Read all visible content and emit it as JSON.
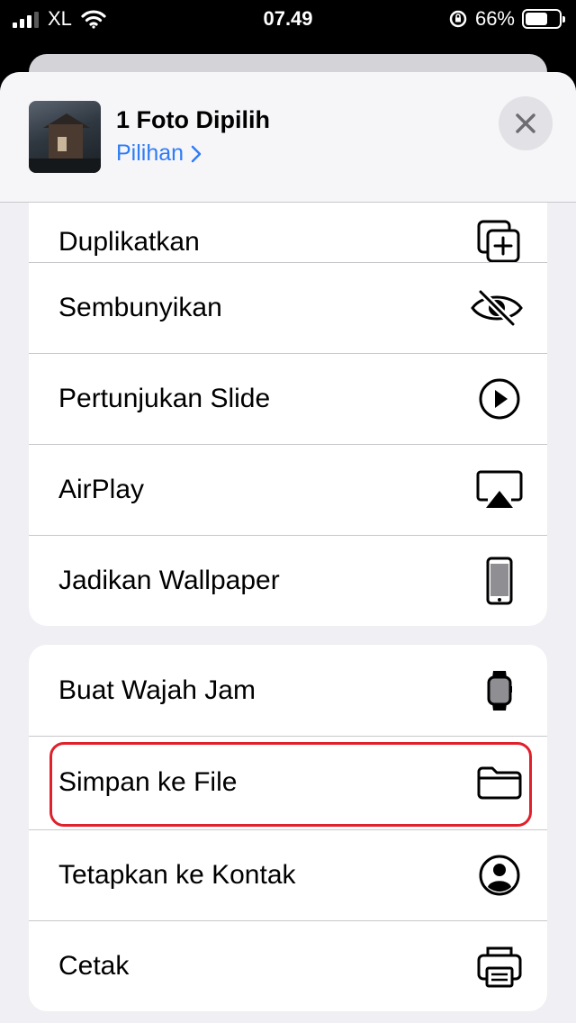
{
  "status_bar": {
    "carrier": "XL",
    "time": "07.49",
    "battery": "66%"
  },
  "header": {
    "title": "1 Foto Dipilih",
    "options_label": "Pilihan"
  },
  "group1": [
    {
      "label": "Duplikatkan",
      "icon": "duplicate-icon"
    },
    {
      "label": "Sembunyikan",
      "icon": "hide-eye-icon"
    },
    {
      "label": "Pertunjukan Slide",
      "icon": "play-circle-icon"
    },
    {
      "label": "AirPlay",
      "icon": "airplay-icon"
    },
    {
      "label": "Jadikan Wallpaper",
      "icon": "phone-icon"
    }
  ],
  "group2": [
    {
      "label": "Buat Wajah Jam",
      "icon": "watch-icon"
    },
    {
      "label": "Simpan ke File",
      "icon": "folder-icon"
    },
    {
      "label": "Tetapkan ke Kontak",
      "icon": "contact-icon"
    },
    {
      "label": "Cetak",
      "icon": "printer-icon"
    }
  ],
  "colors": {
    "accent": "#2f7cf6",
    "highlight": "#e0202a"
  }
}
